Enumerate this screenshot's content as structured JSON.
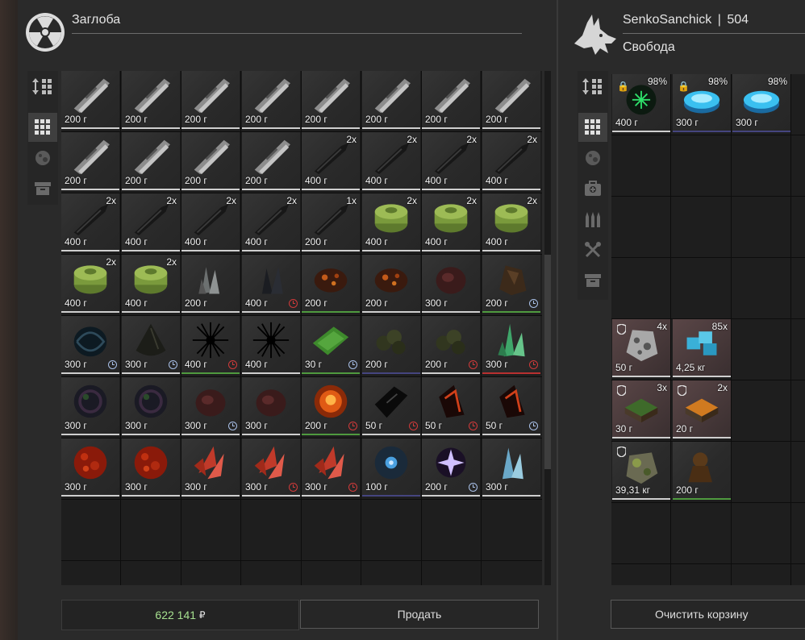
{
  "left": {
    "title": "Заглоба",
    "emblem_icon": "radiation-emblem-icon",
    "sidebar": [
      {
        "icon": "sort-icon",
        "active": false
      },
      {
        "icon": "grid-icon",
        "active": true
      },
      {
        "icon": "artifact-icon",
        "active": false
      },
      {
        "icon": "box-icon",
        "active": false
      }
    ],
    "items": [
      [
        {
          "price": "200 г",
          "icon": "multitool"
        },
        {
          "price": "200 г",
          "icon": "multitool"
        },
        {
          "price": "200 г",
          "icon": "multitool"
        },
        {
          "price": "200 г",
          "icon": "multitool"
        },
        {
          "price": "200 г",
          "icon": "multitool"
        },
        {
          "price": "200 г",
          "icon": "multitool"
        },
        {
          "price": "200 г",
          "icon": "multitool"
        },
        {
          "price": "200 г",
          "icon": "multitool"
        }
      ],
      [
        {
          "price": "200 г",
          "icon": "multitool"
        },
        {
          "price": "200 г",
          "icon": "multitool"
        },
        {
          "price": "200 г",
          "icon": "multitool"
        },
        {
          "price": "200 г",
          "icon": "multitool"
        },
        {
          "price": "400 г",
          "icon": "knife",
          "count": "2x"
        },
        {
          "price": "400 г",
          "icon": "knife",
          "count": "2x"
        },
        {
          "price": "400 г",
          "icon": "knife",
          "count": "2x"
        },
        {
          "price": "400 г",
          "icon": "knife",
          "count": "2x"
        }
      ],
      [
        {
          "price": "400 г",
          "icon": "knife",
          "count": "2x"
        },
        {
          "price": "400 г",
          "icon": "knife",
          "count": "2x"
        },
        {
          "price": "400 г",
          "icon": "knife",
          "count": "2x"
        },
        {
          "price": "400 г",
          "icon": "knife",
          "count": "2x"
        },
        {
          "price": "200 г",
          "icon": "knife",
          "count": "1x"
        },
        {
          "price": "400 г",
          "icon": "mine",
          "count": "2x"
        },
        {
          "price": "400 г",
          "icon": "mine",
          "count": "2x"
        },
        {
          "price": "400 г",
          "icon": "mine",
          "count": "2x"
        }
      ],
      [
        {
          "price": "400 г",
          "icon": "mine",
          "count": "2x"
        },
        {
          "price": "400 г",
          "icon": "mine",
          "count": "2x"
        },
        {
          "price": "200 г",
          "icon": "crystal-gray"
        },
        {
          "price": "400 г",
          "icon": "crystal-dark",
          "timer": "red"
        },
        {
          "price": "200 г",
          "icon": "lava-rock",
          "border": "#4f9a3f"
        },
        {
          "price": "200 г",
          "icon": "lava-rock"
        },
        {
          "price": "300 г",
          "icon": "dark-red-rock"
        },
        {
          "price": "200 г",
          "icon": "brown-rock",
          "border": "#4f9a3f",
          "timer": "blue"
        }
      ],
      [
        {
          "price": "300 г",
          "icon": "black-vortex",
          "timer": "blue"
        },
        {
          "price": "300 г",
          "icon": "dark-drop",
          "timer": "blue"
        },
        {
          "price": "400 г",
          "icon": "black-urchin",
          "border": "#4f9a3f",
          "timer": "red"
        },
        {
          "price": "400 г",
          "icon": "black-urchin"
        },
        {
          "price": "30 г",
          "icon": "green-plate",
          "border": "#4f9a3f",
          "timer": "blue"
        },
        {
          "price": "200 г",
          "icon": "olive-cluster",
          "border": "#45457f"
        },
        {
          "price": "200 г",
          "icon": "olive-cluster",
          "timer": "red"
        },
        {
          "price": "300 г",
          "icon": "green-crystal",
          "border": "#b83030",
          "timer": "red"
        }
      ],
      [
        {
          "price": "300 г",
          "icon": "dark-vortex"
        },
        {
          "price": "300 г",
          "icon": "dark-vortex"
        },
        {
          "price": "300 г",
          "icon": "dark-red-rock",
          "timer": "blue"
        },
        {
          "price": "300 г",
          "icon": "dark-red-rock"
        },
        {
          "price": "200 г",
          "icon": "fireball",
          "border": "#4f9a3f",
          "timer": "red"
        },
        {
          "price": "50 г",
          "icon": "black-shard",
          "timer": "red"
        },
        {
          "price": "50 г",
          "icon": "red-shard",
          "timer": "red"
        },
        {
          "price": "50 г",
          "icon": "red-shard",
          "timer": "blue"
        }
      ],
      [
        {
          "price": "300 г",
          "icon": "red-sponge"
        },
        {
          "price": "300 г",
          "icon": "red-sponge"
        },
        {
          "price": "300 г",
          "icon": "red-crystal"
        },
        {
          "price": "300 г",
          "icon": "red-crystal",
          "timer": "red"
        },
        {
          "price": "300 г",
          "icon": "red-crystal",
          "timer": "red"
        },
        {
          "price": "100 г",
          "icon": "blue-orb",
          "border": "#45457f"
        },
        {
          "price": "200 г",
          "icon": "violet-star",
          "timer": "blue"
        },
        {
          "price": "300 г",
          "icon": "ice-crystal"
        }
      ]
    ],
    "empty_rows": 2
  },
  "right": {
    "player_name": "SenkoSanchick",
    "separator": "|",
    "player_level": "504",
    "faction": "Свобода",
    "emblem_icon": "wolf-emblem-icon",
    "sidebar": [
      {
        "icon": "sort-icon",
        "active": false
      },
      {
        "icon": "grid-icon",
        "active": true
      },
      {
        "icon": "artifact-icon",
        "active": false
      },
      {
        "icon": "medkit-icon",
        "active": false
      },
      {
        "icon": "ammo-icon",
        "active": false
      },
      {
        "icon": "tools-icon",
        "active": false
      },
      {
        "icon": "box-icon",
        "active": false
      }
    ],
    "items": [
      {
        "row": 0,
        "col": 0,
        "price": "400 г",
        "icon": "green-spark",
        "durability": "98%",
        "locked": true
      },
      {
        "row": 0,
        "col": 1,
        "price": "300 г",
        "icon": "blue-disc",
        "durability": "98%",
        "locked": true,
        "border": "#45457f"
      },
      {
        "row": 0,
        "col": 2,
        "price": "300 г",
        "icon": "blue-disc",
        "durability": "98%",
        "locked": false,
        "border": "#45457f"
      },
      {
        "row": 4,
        "col": 0,
        "price": "50 г",
        "icon": "gray-cheese-rock",
        "count": "4x",
        "shield": true,
        "bg": "#5a4647"
      },
      {
        "row": 4,
        "col": 1,
        "price": "4,25 кг",
        "icon": "blue-ice-cubes",
        "count": "85x",
        "bg": "#5a4647"
      },
      {
        "row": 5,
        "col": 0,
        "price": "30 г",
        "icon": "green-ammo-box",
        "count": "3x",
        "shield": true,
        "bg": "#5a4647"
      },
      {
        "row": 5,
        "col": 1,
        "price": "20 г",
        "icon": "orange-ammo-box",
        "count": "2x",
        "shield": true,
        "bg": "#5a4647"
      },
      {
        "row": 6,
        "col": 0,
        "price": "39,31 кг",
        "icon": "mossy-rock",
        "shield": true
      },
      {
        "row": 6,
        "col": 1,
        "price": "200 г",
        "icon": "brown-figure",
        "border": "#4f9a3f"
      }
    ]
  },
  "footer": {
    "money": "622 141",
    "currency": "₽",
    "sell_button": "Продать",
    "clear_cart_button": "Очистить корзину"
  },
  "colors": {
    "timer_red": "#d03a3a",
    "timer_blue": "#a9c0e8",
    "money_green": "#a6e08f"
  }
}
